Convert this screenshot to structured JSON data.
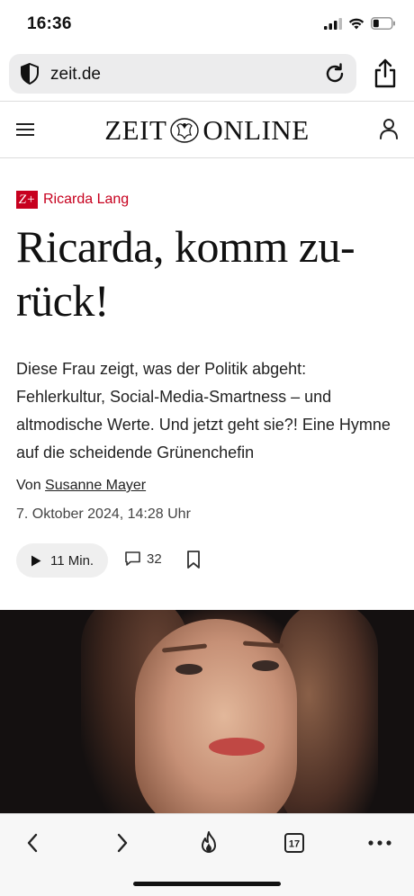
{
  "status_bar": {
    "time": "16:36"
  },
  "browser": {
    "url": "zeit.de"
  },
  "site": {
    "logo_left": "ZEIT",
    "logo_right": "ONLINE"
  },
  "article": {
    "badge": "Z+",
    "kicker": "Ricarda Lang",
    "headline_line1": "Ricarda, komm zu-",
    "headline_line2": "rück!",
    "summary": "Diese Frau zeigt, was der Politik abgeht: Fehlerkultur, Social-Media-Smartness – und altmodische Werte. Und jetzt geht sie?! Eine Hymne auf die scheidende Grünenchefin",
    "byline_prefix": "Von",
    "author": "Susanne Mayer",
    "date": "7. Oktober 2024, 14:28 Uhr",
    "audio_duration": "11 Min.",
    "comment_count": "32"
  },
  "bottom_bar": {
    "tabs_count": "17"
  },
  "colors": {
    "accent": "#c7001e",
    "text": "#111111",
    "url_bar_bg": "#ececed"
  }
}
